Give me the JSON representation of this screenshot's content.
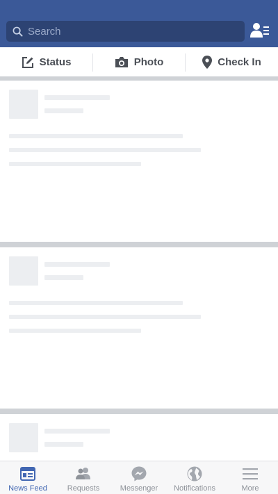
{
  "colors": {
    "header_bg": "#3b5998",
    "search_bg": "#2d4373",
    "active_tab": "#4267b2",
    "inactive_tab": "#8e9299",
    "skeleton": "#eceef1",
    "separator": "#cfd2d6"
  },
  "header": {
    "search_placeholder": "Search",
    "search_icon": "search-icon",
    "friends_icon": "friend-list-icon"
  },
  "composer": {
    "items": [
      {
        "label": "Status",
        "icon": "edit-icon"
      },
      {
        "label": "Photo",
        "icon": "camera-icon"
      },
      {
        "label": "Check In",
        "icon": "location-pin-icon"
      }
    ]
  },
  "tabbar": {
    "tabs": [
      {
        "label": "News Feed",
        "icon": "news-feed-icon",
        "active": true
      },
      {
        "label": "Requests",
        "icon": "friend-requests-icon",
        "active": false
      },
      {
        "label": "Messenger",
        "icon": "messenger-icon",
        "active": false
      },
      {
        "label": "Notifications",
        "icon": "globe-icon",
        "active": false
      },
      {
        "label": "More",
        "icon": "menu-icon",
        "active": false
      }
    ]
  }
}
